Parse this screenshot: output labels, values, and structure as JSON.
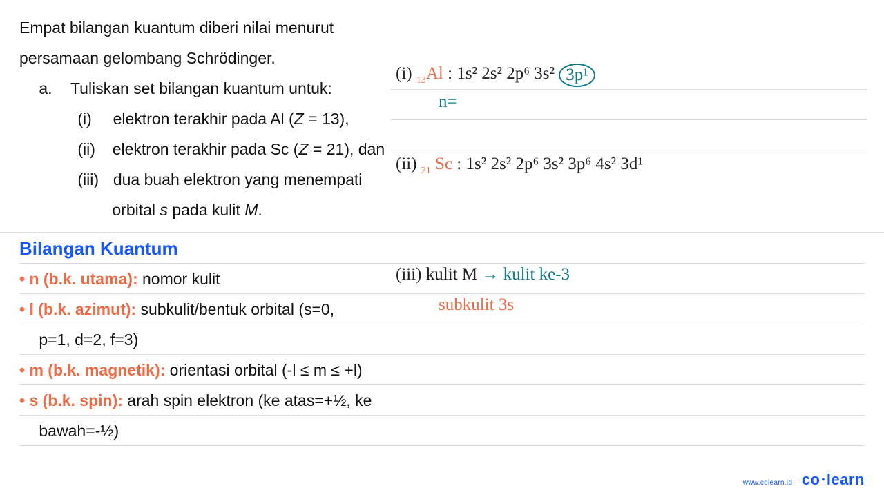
{
  "question": {
    "intro1": "Empat bilangan kuantum diberi nilai menurut",
    "intro2": "persamaan gelombang Schrödinger.",
    "a_label": "a.",
    "a_text": "Tuliskan set bilangan kuantum untuk:",
    "i_label": "(i)",
    "i_text_1": "elektron terakhir pada Al (",
    "i_text_z": "Z",
    "i_text_2": " = 13),",
    "ii_label": "(ii)",
    "ii_text_1": "elektron terakhir pada Sc (",
    "ii_text_z": "Z",
    "ii_text_2": " = 21), dan",
    "iii_label": "(iii)",
    "iii_text_1": "dua buah elektron yang menempati",
    "iii_text_2a": "orbital ",
    "iii_text_2s": "s",
    "iii_text_2b": " pada kulit ",
    "iii_text_2m": "M",
    "iii_text_2c": "."
  },
  "notes": {
    "heading": "Bilangan Kuantum",
    "n_label": "n (b.k. utama):",
    "n_text": " nomor kulit",
    "l_label": "l (b.k. azimut):",
    "l_text": " subkulit/bentuk orbital (s=0,",
    "l_text_cont": "p=1, d=2, f=3)",
    "m_label": "m (b.k. magnetik):",
    "m_text": " orientasi orbital (-l ≤ m ≤ +l)",
    "s_label": "s (b.k. spin):",
    "s_text": " arah spin elektron (ke atas=+½, ke",
    "s_text_cont": "bawah=-½)"
  },
  "hw": {
    "i_label": "(i)",
    "i_atom_sub": "13",
    "i_atom": "Al",
    "i_colon": " : ",
    "i_cfg": "1s² 2s² 2p⁶ 3s²",
    "i_circled": "3p¹",
    "i_n": "n=",
    "ii_label": "(ii)",
    "ii_atom_sub": "21",
    "ii_atom": " Sc",
    "ii_colon": " : ",
    "ii_cfg": "1s² 2s² 2p⁶ 3s² 3p⁶ 4s² 3d¹",
    "iii_label": "(iii)",
    "iii_black": " kulit  M ",
    "iii_arrow": "→",
    "iii_teal": " kulit  ke-3",
    "iii_sub": "subkulit  3s"
  },
  "footer": {
    "url": "www.colearn.id",
    "brand_left": "co",
    "brand_dot": "•",
    "brand_right": "learn"
  }
}
